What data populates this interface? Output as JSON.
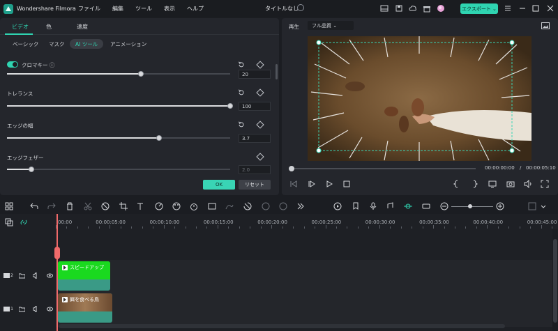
{
  "titlebar": {
    "app_name": "Wondershare Filmora",
    "menu": [
      "ファイル",
      "編集",
      "ツール",
      "表示",
      "ヘルプ"
    ],
    "doc_title": "タイトルなし",
    "export_label": "エクスポート ⌄",
    "accent": "#2fd4b1"
  },
  "left_panel": {
    "tabs": [
      "ビデオ",
      "色",
      "速度"
    ],
    "active_tab": "ビデオ",
    "subtabs": [
      "ベーシック",
      "マスク",
      "AI ツール",
      "アニメーション"
    ],
    "active_subtab": "AI ツール",
    "chroma_label": "クロマキー ⓘ",
    "chroma_enabled": true,
    "params": [
      {
        "label": "",
        "value": "20",
        "fraction": 0.6
      },
      {
        "label": "トレランス",
        "value": "100",
        "fraction": 1.0
      },
      {
        "label": "エッジの幅",
        "value": "3.7",
        "fraction": 0.68
      },
      {
        "label": "エッジフェザー",
        "value": "2.0",
        "fraction": 0.11
      }
    ],
    "ok_label": "OK",
    "reset_label": "リセット"
  },
  "preview": {
    "label": "再生",
    "quality": "フル品質 ⌄",
    "time_current": "00:00:00:00",
    "time_sep": "/",
    "time_total": "00:00:05:10",
    "progress": 0.0
  },
  "timeline": {
    "ruler": [
      "00:00",
      "00:00:05:00",
      "00:00:10:00",
      "00:00:15:00",
      "00:00:20:00",
      "00:00:25:00",
      "00:00:30:00",
      "00:00:35:00",
      "00:00:40:00",
      "00:00:45:00"
    ],
    "tracks": [
      {
        "number": "2",
        "clip_label": "スピードアップ",
        "clip_color": "#1ad91f"
      },
      {
        "number": "1",
        "clip_label": "餌を食べる鳥",
        "clip_color": "#3a9a86"
      }
    ]
  }
}
